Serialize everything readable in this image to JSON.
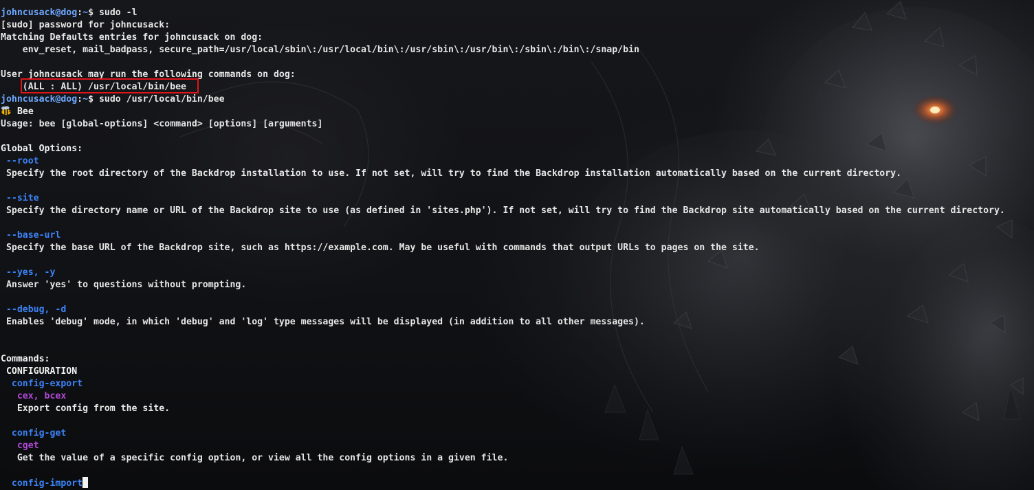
{
  "prompt": {
    "user_host": "johncusack@dog",
    "sep": ":",
    "path": "~",
    "symbol": "$ "
  },
  "lines": {
    "cmd1": "sudo -l",
    "sudo_password": "[sudo] password for johncusack:",
    "matching_defaults": "Matching Defaults entries for johncusack on dog:",
    "defaults_values": "    env_reset, mail_badpass, secure_path=/usr/local/sbin\\:/usr/local/bin\\:/usr/sbin\\:/usr/bin\\:/sbin\\:/bin\\:/snap/bin",
    "user_may_run": "User johncusack may run the following commands on dog:",
    "allowed_cmd": "    (ALL : ALL) /usr/local/bin/bee",
    "cmd2": "sudo /usr/local/bin/bee",
    "bee_title": "Bee",
    "usage": "Usage: bee [global-options] <command> [options] [arguments]",
    "global_options_heading": "Global Options:"
  },
  "global_options": [
    {
      "flag": " --root",
      "desc": " Specify the root directory of the Backdrop installation to use. If not set, will try to find the Backdrop installation automatically based on the current directory."
    },
    {
      "flag": " --site",
      "desc": " Specify the directory name or URL of the Backdrop site to use (as defined in 'sites.php'). If not set, will try to find the Backdrop site automatically based on the current directory."
    },
    {
      "flag": " --base-url",
      "desc": " Specify the base URL of the Backdrop site, such as https://example.com. May be useful with commands that output URLs to pages on the site."
    },
    {
      "flag": " --yes, -y",
      "desc": " Answer 'yes' to questions without prompting."
    },
    {
      "flag": " --debug, -d",
      "desc": " Enables 'debug' mode, in which 'debug' and 'log' type messages will be displayed (in addition to all other messages)."
    }
  ],
  "commands": {
    "heading": "Commands:",
    "category": " CONFIGURATION",
    "items": [
      {
        "name": "  config-export",
        "aliases": "   cex, bcex",
        "desc": "   Export config from the site."
      },
      {
        "name": "  config-get",
        "aliases": "   cget",
        "desc": "   Get the value of a specific config option, or view all the config options in a given file."
      },
      {
        "name": "  config-import"
      }
    ]
  },
  "colors": {
    "prompt": "#6ea8ff",
    "option_flag": "#3b82f6",
    "alias": "#b04ad8",
    "highlight_box": "#e0151b",
    "text": "#e6e6e6"
  },
  "icons": {
    "bee": "bee-icon"
  }
}
